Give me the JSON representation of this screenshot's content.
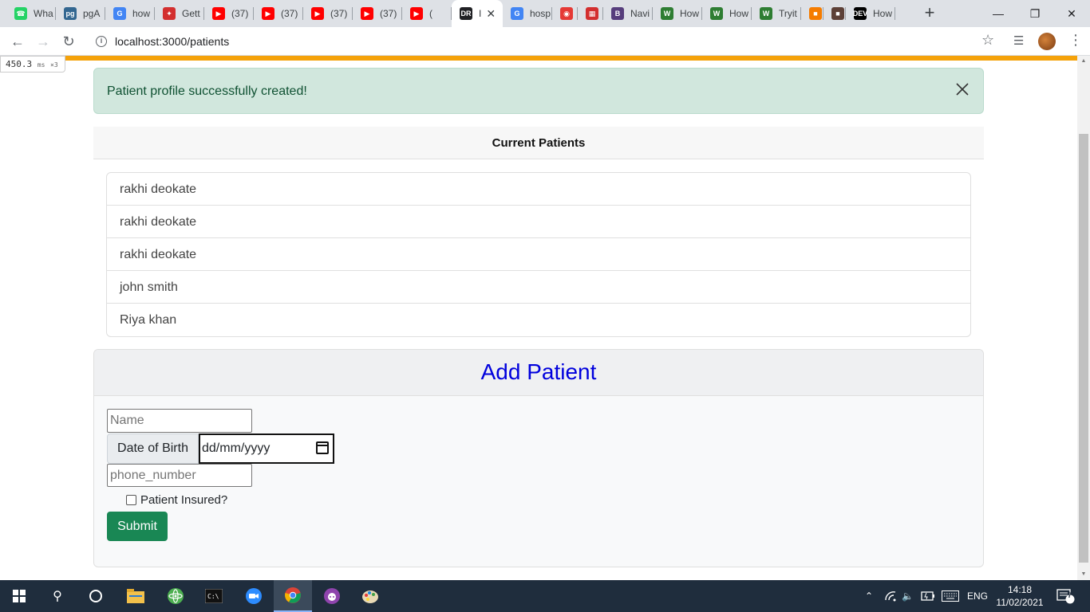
{
  "browser": {
    "tabs": [
      {
        "label": "Wha",
        "icon": "whatsapp-icon",
        "color": "#25d366"
      },
      {
        "label": "pgA",
        "icon": "pgadmin-icon",
        "color": "#336791"
      },
      {
        "label": "how",
        "icon": "google-icon",
        "color": "#4285f4"
      },
      {
        "label": "Gett",
        "icon": "bird-icon",
        "color": "#d32f2f"
      },
      {
        "label": "(37)",
        "icon": "youtube-icon",
        "color": "#ff0000"
      },
      {
        "label": "(37)",
        "icon": "youtube-icon",
        "color": "#ff0000"
      },
      {
        "label": "(37)",
        "icon": "youtube-icon",
        "color": "#ff0000"
      },
      {
        "label": "(37)",
        "icon": "youtube-icon",
        "color": "#ff0000"
      },
      {
        "label": "(",
        "icon": "youtube-icon",
        "color": "#ff0000"
      },
      {
        "label": "I",
        "icon": "react-devtools-icon",
        "color": "#202124"
      },
      {
        "label": "hosp",
        "icon": "google-icon",
        "color": "#4285f4"
      },
      {
        "label": "",
        "icon": "shield-red-icon",
        "color": "#e53935"
      },
      {
        "label": "",
        "icon": "bookmark-icon",
        "color": "#d32f2f"
      },
      {
        "label": "Navi",
        "icon": "bootstrap-icon",
        "color": "#563d7c"
      },
      {
        "label": "How",
        "icon": "wikihow-icon",
        "color": "#2e7d32"
      },
      {
        "label": "How",
        "icon": "wikihow-icon",
        "color": "#2e7d32"
      },
      {
        "label": "Tryit",
        "icon": "w3schools-icon",
        "color": "#2e7d32"
      },
      {
        "label": "",
        "icon": "extension-icon",
        "color": "#f57c00"
      },
      {
        "label": "",
        "icon": "extension-icon",
        "color": "#5d4037"
      },
      {
        "label": "How",
        "icon": "dev-icon",
        "color": "#000000"
      }
    ],
    "url": "localhost:3000/patients"
  },
  "perf": {
    "value": "450.3",
    "unit": "ms",
    "multiplier": "×3"
  },
  "alert": {
    "message": "Patient profile successfully created!"
  },
  "patients": {
    "title": "Current Patients",
    "items": [
      "rakhi deokate",
      "rakhi deokate",
      "rakhi deokate",
      "john smith",
      "Riya khan"
    ]
  },
  "form": {
    "title": "Add Patient",
    "name_placeholder": "Name",
    "dob_label": "Date of Birth",
    "dob_placeholder": "dd/mm/yyyy",
    "phone_placeholder": "phone_number",
    "insured_label": "Patient Insured?",
    "submit_label": "Submit"
  },
  "taskbar": {
    "lang": "ENG",
    "time": "14:18",
    "date": "11/02/2021",
    "notifications": "7"
  },
  "colors": {
    "accent_loadbar": "#f5a20a",
    "alert_bg": "#d1e7dd",
    "form_title": "#0000dd",
    "submit_bg": "#198754"
  }
}
